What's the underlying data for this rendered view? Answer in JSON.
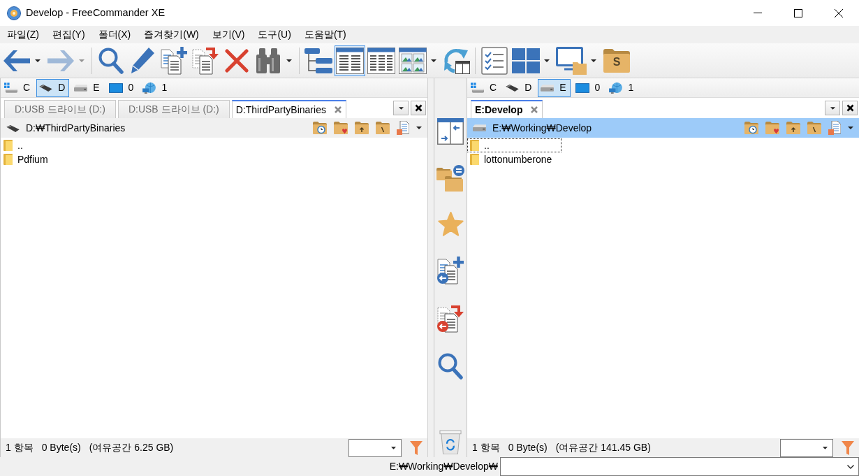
{
  "window": {
    "title": "Develop - FreeCommander XE"
  },
  "menu": [
    "파일(Z)",
    "편집(Y)",
    "폴더(X)",
    "즐겨찾기(W)",
    "보기(V)",
    "도구(U)",
    "도움말(T)"
  ],
  "toolbar": [
    [
      {
        "selected": false,
        "disabled": false,
        "dropdown": true
      },
      {
        "selected": false,
        "disabled": true,
        "dropdown": true
      }
    ],
    [
      {
        "selected": false,
        "disabled": false,
        "dropdown": false
      },
      {
        "selected": false,
        "disabled": false,
        "dropdown": false
      },
      {
        "selected": false,
        "disabled": false,
        "dropdown": false
      },
      {
        "selected": false,
        "disabled": false,
        "dropdown": false
      },
      {
        "selected": false,
        "disabled": false,
        "dropdown": false
      },
      {
        "selected": false,
        "disabled": false,
        "dropdown": true
      }
    ],
    [
      {
        "selected": false,
        "disabled": false,
        "dropdown": false
      },
      {
        "selected": true,
        "disabled": false,
        "dropdown": false
      },
      {
        "selected": false,
        "disabled": false,
        "dropdown": false
      },
      {
        "selected": false,
        "disabled": false,
        "dropdown": true
      },
      {
        "selected": false,
        "disabled": false,
        "dropdown": false
      }
    ],
    [
      {
        "selected": false,
        "disabled": false,
        "dropdown": false
      },
      {
        "selected": false,
        "disabled": false,
        "dropdown": true
      },
      {
        "selected": false,
        "disabled": false,
        "dropdown": true
      },
      {
        "selected": false,
        "disabled": false,
        "dropdown": false,
        "label": "S"
      }
    ]
  ],
  "panels": [
    {
      "active": false,
      "drives": [
        {
          "kind": "system",
          "label": "C",
          "selected": false
        },
        {
          "kind": "usb",
          "label": "D",
          "selected": true
        },
        {
          "kind": "drive",
          "label": "E",
          "selected": false
        },
        {
          "kind": "desktop",
          "label": "0",
          "selected": false
        },
        {
          "kind": "network",
          "label": "1",
          "selected": false
        }
      ],
      "tabs": [
        {
          "label": "D:USB 드라이브 (D:)",
          "selected": false
        },
        {
          "label": "D:USB 드라이브 (D:)",
          "selected": false
        },
        {
          "label": "D:ThirdPartyBinaries",
          "selected": true
        }
      ],
      "path": {
        "kind": "usb",
        "text": "D:₩ThirdPartyBinaries"
      },
      "files": [
        {
          "name": "..",
          "focused": false
        },
        {
          "name": "Pdfium",
          "focused": false
        }
      ],
      "status": [
        "1 항목",
        "0 Byte(s)",
        "(여유공간 6.25 GB)"
      ]
    },
    {
      "active": true,
      "drives": [
        {
          "kind": "system",
          "label": "C",
          "selected": false
        },
        {
          "kind": "usb",
          "label": "D",
          "selected": false
        },
        {
          "kind": "drive",
          "label": "E",
          "selected": true
        },
        {
          "kind": "desktop",
          "label": "0",
          "selected": false
        },
        {
          "kind": "network",
          "label": "1",
          "selected": false
        }
      ],
      "tabs": [
        {
          "label": "E:Develop",
          "selected": true
        }
      ],
      "path": {
        "kind": "drive",
        "text": "E:₩Working₩Develop"
      },
      "files": [
        {
          "name": "..",
          "focused": true
        },
        {
          "name": "lottonumberone",
          "focused": false
        }
      ],
      "status": [
        "1 항목",
        "0 Byte(s)",
        "(여유공간 141.45 GB)"
      ]
    }
  ],
  "command_line": {
    "path": "E:₩Working₩Develop₩"
  }
}
